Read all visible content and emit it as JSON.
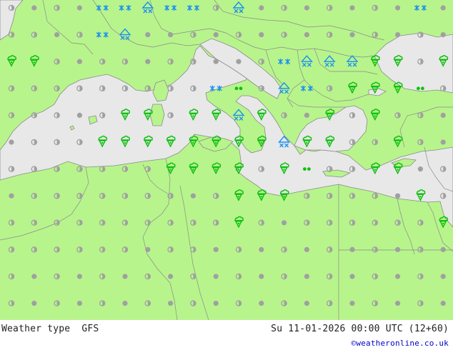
{
  "footer": {
    "product": "Weather type  GFS",
    "valid_time": "Su 11-01-2026 00:00 UTC (12+60)",
    "credit": "©weatheronline.co.uk"
  },
  "colors": {
    "land": "#b8f48c",
    "sea": "#e8e8e8",
    "border": "#8a8a8a",
    "dry_symbol": "#a0a0a0",
    "rain_symbol": "#10c010",
    "snow_symbol": "#1a8ff0"
  },
  "legend_symbols": {
    "dry": "dry-dot-symbol",
    "cloudy": "half-cloud-symbol",
    "rain": "rain-shower-symbol",
    "drizzle": "drizzle-symbol",
    "snow": "snowflake-symbol",
    "snow_shower": "snow-shower-symbol"
  }
}
